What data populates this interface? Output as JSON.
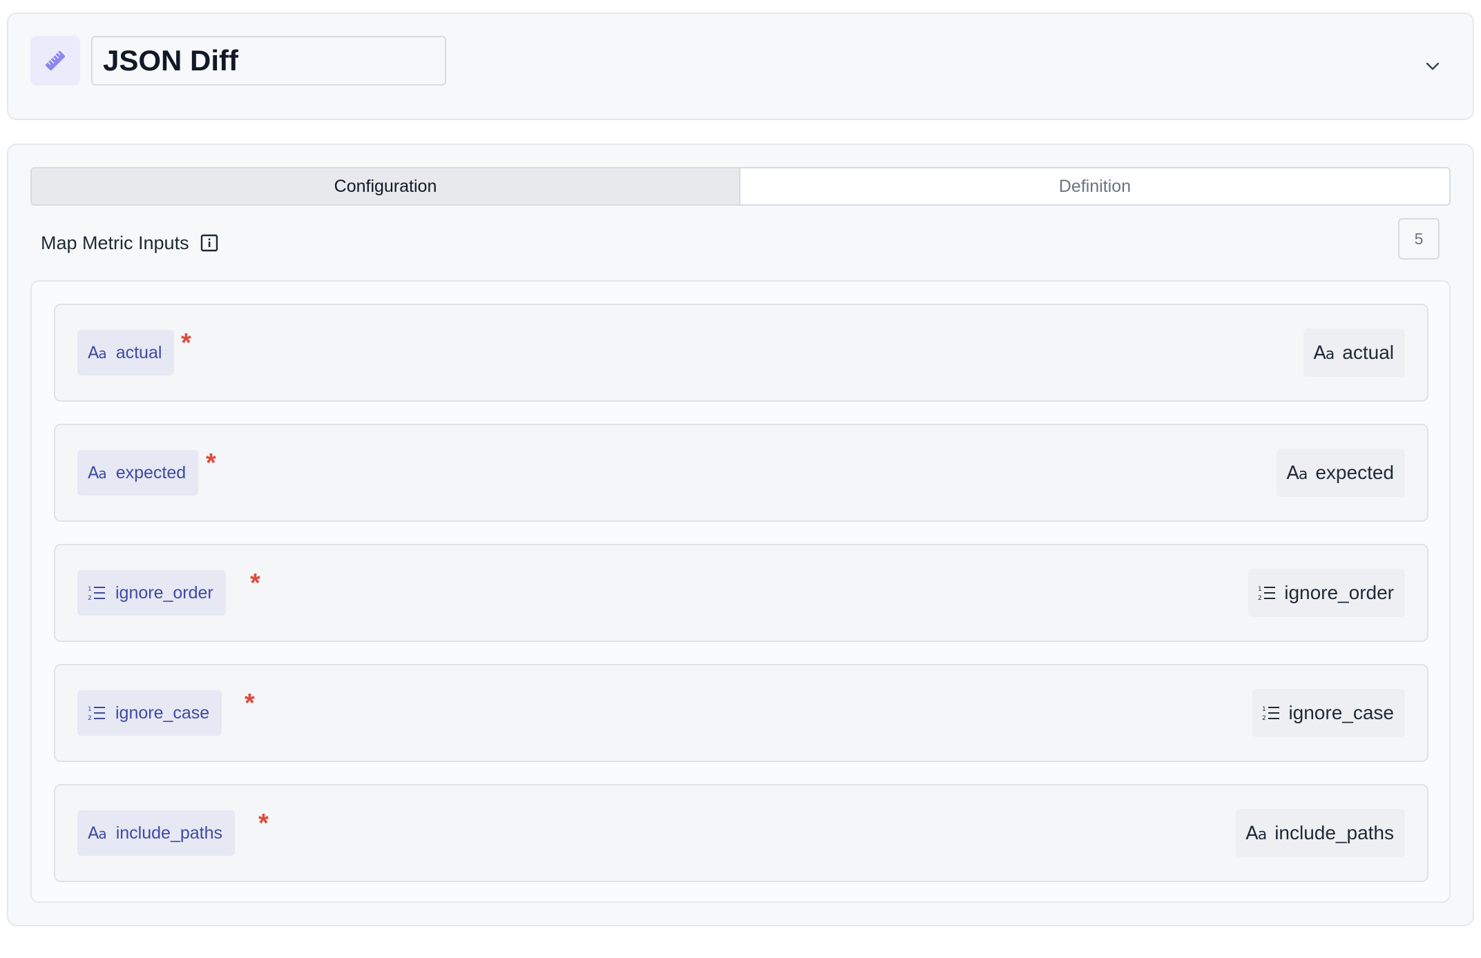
{
  "header": {
    "title_value": "JSON Diff",
    "metric_icon": "ruler-icon",
    "toggle_icon": "chevron-down-icon"
  },
  "tabs": [
    {
      "label": "Configuration",
      "active": true
    },
    {
      "label": "Definition",
      "active": false
    }
  ],
  "section": {
    "label": "Map Metric Inputs",
    "info_icon": "info-icon",
    "count": "5"
  },
  "inputs": [
    {
      "name": "actual",
      "type_icon": "text-type-icon",
      "required": "*",
      "mapped_to": "actual"
    },
    {
      "name": "expected",
      "type_icon": "text-type-icon",
      "required": "*",
      "mapped_to": "expected"
    },
    {
      "name": "ignore_order",
      "type_icon": "list-type-icon",
      "required": "*",
      "mapped_to": "ignore_order"
    },
    {
      "name": "ignore_case",
      "type_icon": "list-type-icon",
      "required": "*",
      "mapped_to": "ignore_case"
    },
    {
      "name": "include_paths",
      "type_icon": "text-type-icon",
      "required": "*",
      "mapped_to": "include_paths"
    }
  ],
  "colors": {
    "accent": "#3e4aa0",
    "required": "#e04a3b",
    "icon_tile": "#ebebfb",
    "ruler": "#8b86f0"
  }
}
